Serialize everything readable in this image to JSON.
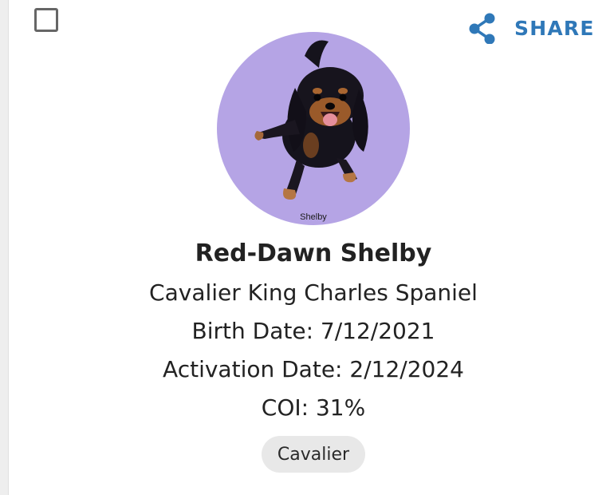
{
  "card": {
    "share_label": "SHARE",
    "avatar_caption": "Shelby",
    "name": "Red-Dawn Shelby",
    "breed": "Cavalier King Charles Spaniel",
    "birth_date": "Birth Date: 7/12/2021",
    "activation_date": "Activation Date: 2/12/2024",
    "coi": "COI: 31%",
    "tag": "Cavalier"
  },
  "colors": {
    "accent": "#2f78b8",
    "avatar_background": "#b5a4e5",
    "chip_background": "#e8e8e8",
    "text": "#222222"
  },
  "icons": {
    "share": "share-icon",
    "checkbox": "checkbox-unchecked"
  }
}
